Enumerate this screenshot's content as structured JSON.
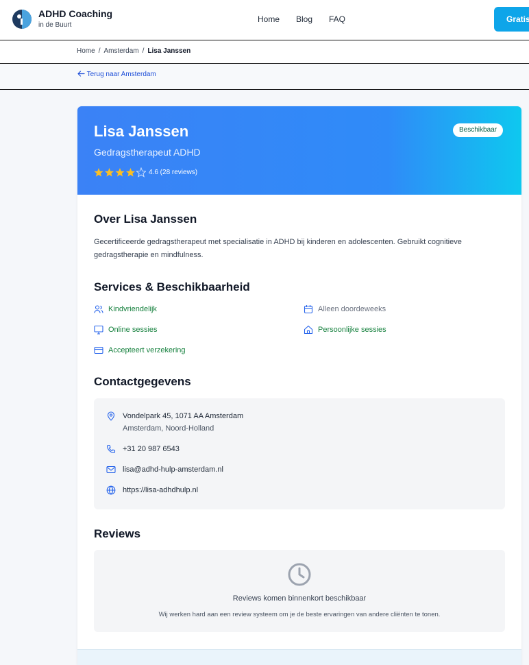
{
  "header": {
    "brand_title": "ADHD Coaching",
    "brand_subtitle": "in de Buurt",
    "nav": [
      "Home",
      "Blog",
      "FAQ"
    ],
    "cta_label": "Gratis"
  },
  "breadcrumb": {
    "home": "Home",
    "city": "Amsterdam",
    "current": "Lisa Janssen",
    "separator": "/"
  },
  "back_link": "Terug naar Amsterdam",
  "profile": {
    "name": "Lisa Janssen",
    "role": "Gedragstherapeut ADHD",
    "rating": 4.6,
    "rating_text": "4.6 (28 reviews)",
    "stars_total": 5,
    "badge": "Beschikbaar"
  },
  "about": {
    "heading": "Over Lisa Janssen",
    "text": "Gecertificeerde gedragstherapeut met specialisatie in ADHD bij kinderen en adolescenten. Gebruikt cognitieve gedragstherapie en mindfulness."
  },
  "services": {
    "heading": "Services & Beschikbaarheid",
    "items": [
      {
        "label": "Kindvriendelijk",
        "icon": "users-icon",
        "active": true
      },
      {
        "label": "Alleen doordeweeks",
        "icon": "calendar-icon",
        "active": false
      },
      {
        "label": "Online sessies",
        "icon": "monitor-icon",
        "active": true
      },
      {
        "label": "Persoonlijke sessies",
        "icon": "home-icon",
        "active": true
      },
      {
        "label": "Accepteert verzekering",
        "icon": "credit-card-icon",
        "active": true
      }
    ]
  },
  "contact": {
    "heading": "Contactgegevens",
    "address": "Vondelpark 45, 1071 AA Amsterdam",
    "region": "Amsterdam, Noord-Holland",
    "phone": "+31 20 987 6543",
    "email": "lisa@adhd-hulp-amsterdam.nl",
    "website": "https://lisa-adhdhulp.nl"
  },
  "reviews": {
    "heading": "Reviews",
    "title": "Reviews komen binnenkort beschikbaar",
    "subtitle": "Wij werken hard aan een review systeem om je de beste ervaringen van andere cliënten te tonen."
  },
  "colors": {
    "hero_start": "#3b82f6",
    "hero_end": "#0ec8ef",
    "star": "#fbbf24",
    "service_active": "#15803d",
    "icon_blue": "#2563eb",
    "cta": "#0ea5e9"
  }
}
